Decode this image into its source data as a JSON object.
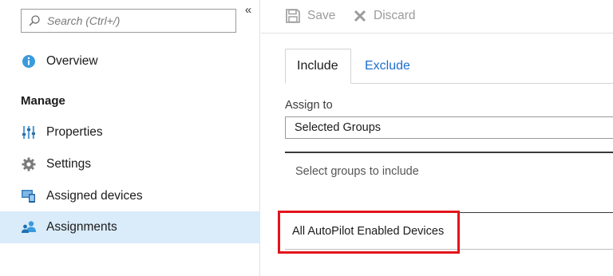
{
  "sidebar": {
    "search_placeholder": "Search (Ctrl+/)",
    "collapse_glyph": "«",
    "overview": {
      "label": "Overview",
      "icon": "info-icon"
    },
    "section_title": "Manage",
    "items": [
      {
        "label": "Properties",
        "icon": "properties-icon"
      },
      {
        "label": "Settings",
        "icon": "gear-icon"
      },
      {
        "label": "Assigned devices",
        "icon": "devices-icon"
      },
      {
        "label": "Assignments",
        "icon": "assignments-icon",
        "selected": true
      }
    ]
  },
  "toolbar": {
    "save_label": "Save",
    "discard_label": "Discard"
  },
  "tabs": [
    {
      "label": "Include",
      "active": true
    },
    {
      "label": "Exclude",
      "active": false
    }
  ],
  "form": {
    "assign_to_label": "Assign to",
    "assign_to_value": "Selected Groups",
    "select_groups_text": "Select groups to include",
    "groups": [
      "All AutoPilot Enabled Devices"
    ]
  },
  "colors": {
    "accent_blue": "#1c6fd1",
    "selected_bg": "#daebf9",
    "highlight_red": "#e3141b",
    "disabled_gray": "#9b9b9b"
  }
}
